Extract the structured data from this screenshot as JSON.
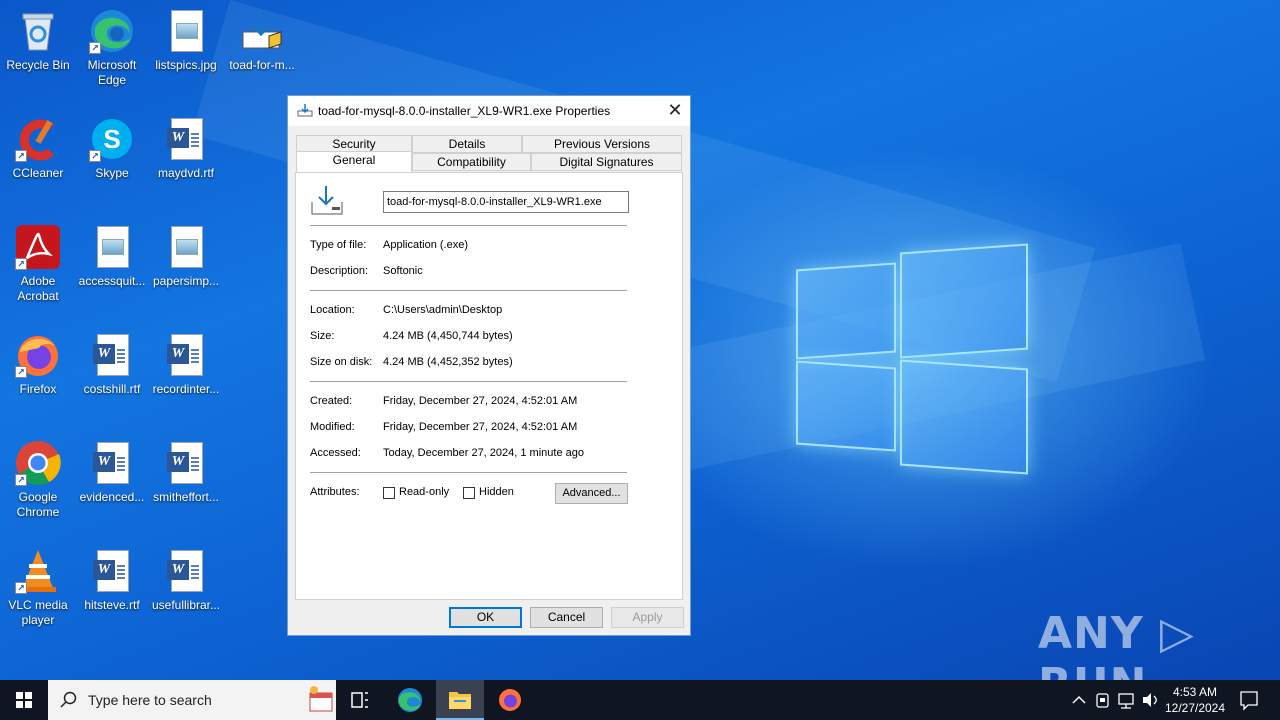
{
  "desktop": {
    "icons": [
      {
        "label": "Recycle Bin"
      },
      {
        "label": "Microsoft Edge"
      },
      {
        "label": "listspics.jpg"
      },
      {
        "label": "toad-for-m..."
      },
      {
        "label": "CCleaner"
      },
      {
        "label": "Skype"
      },
      {
        "label": "maydvd.rtf"
      },
      {
        "label": "Adobe Acrobat"
      },
      {
        "label": "accessquit..."
      },
      {
        "label": "papersimp..."
      },
      {
        "label": "Firefox"
      },
      {
        "label": "costshill.rtf"
      },
      {
        "label": "recordinter..."
      },
      {
        "label": "Google Chrome"
      },
      {
        "label": "evidenced..."
      },
      {
        "label": "smitheffort..."
      },
      {
        "label": "VLC media player"
      },
      {
        "label": "hitsteve.rtf"
      },
      {
        "label": "usefullibrar..."
      }
    ],
    "watermark": "ANY ▷ RUN"
  },
  "dialog": {
    "title": "toad-for-mysql-8.0.0-installer_XL9-WR1.exe Properties",
    "tabs_top": [
      "Security",
      "Details",
      "Previous Versions"
    ],
    "tabs_bottom": [
      "General",
      "Compatibility",
      "Digital Signatures"
    ],
    "active_tab": "General",
    "filename": "toad-for-mysql-8.0.0-installer_XL9-WR1.exe",
    "rows": {
      "type_label": "Type of file:",
      "type_value": "Application (.exe)",
      "desc_label": "Description:",
      "desc_value": "Softonic",
      "location_label": "Location:",
      "location_value": "C:\\Users\\admin\\Desktop",
      "size_label": "Size:",
      "size_value": "4.24 MB (4,450,744 bytes)",
      "disk_label": "Size on disk:",
      "disk_value": "4.24 MB (4,452,352 bytes)",
      "created_label": "Created:",
      "created_value": "Friday, December 27, 2024, 4:52:01 AM",
      "modified_label": "Modified:",
      "modified_value": "Friday, December 27, 2024, 4:52:01 AM",
      "accessed_label": "Accessed:",
      "accessed_value": "Today, December 27, 2024, 1 minute ago",
      "attributes_label": "Attributes:"
    },
    "readonly_label": "Read-only",
    "readonly_checked": false,
    "hidden_label": "Hidden",
    "hidden_checked": false,
    "advanced_label": "Advanced...",
    "ok_label": "OK",
    "cancel_label": "Cancel",
    "apply_label": "Apply"
  },
  "taskbar": {
    "search_placeholder": "Type here to search",
    "time": "4:53 AM",
    "date": "12/27/2024",
    "accent_color": "#76b9ed"
  }
}
